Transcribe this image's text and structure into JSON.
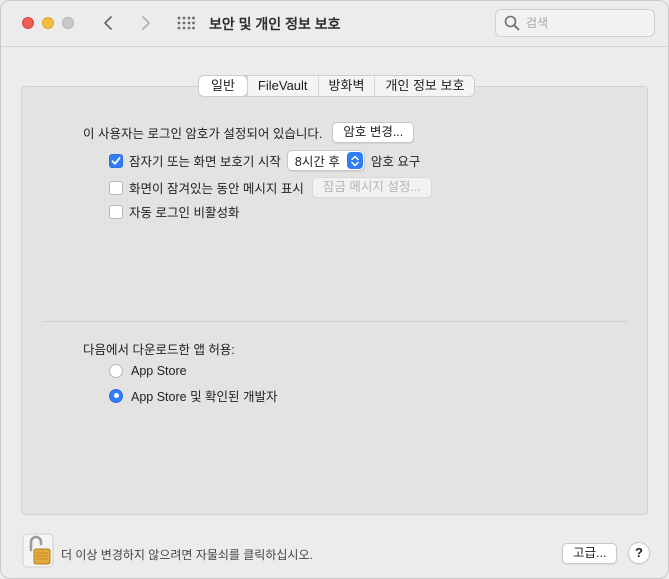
{
  "window": {
    "title": "보안 및 개인 정보 보호"
  },
  "search": {
    "placeholder": "검색"
  },
  "tabs": [
    {
      "label": "일반",
      "active": true
    },
    {
      "label": "FileVault",
      "active": false
    },
    {
      "label": "방화벽",
      "active": false
    },
    {
      "label": "개인 정보 보호",
      "active": false
    }
  ],
  "general": {
    "password_text": "이 사용자는 로그인 암호가 설정되어 있습니다.",
    "change_password_button": "암호 변경...",
    "require_password": {
      "label": "잠자기 또는 화면 보호기 시작",
      "checked": true,
      "select_value": "8시간 후",
      "suffix": "암호 요구"
    },
    "show_message": {
      "label": "화면이 잠겨있는 동안 메시지 표시",
      "checked": false,
      "button": "잠금 메시지 설정..."
    },
    "disable_auto_login": {
      "label": "자동 로그인 비활성화",
      "checked": false
    },
    "allow_apps_heading": "다음에서 다운로드한 앱 허용:",
    "allow_apps_options": [
      {
        "label": "App Store",
        "selected": false
      },
      {
        "label": "App Store 및 확인된 개발자",
        "selected": true
      }
    ]
  },
  "footer": {
    "lock_text": "더 이상 변경하지 않으려면 자물쇠를 클릭하십시오.",
    "advanced_button": "고급...",
    "help_button": "?"
  },
  "colors": {
    "accent": "#2f7ef5",
    "close": "#ee5e57",
    "minimize": "#f5bd3a"
  }
}
